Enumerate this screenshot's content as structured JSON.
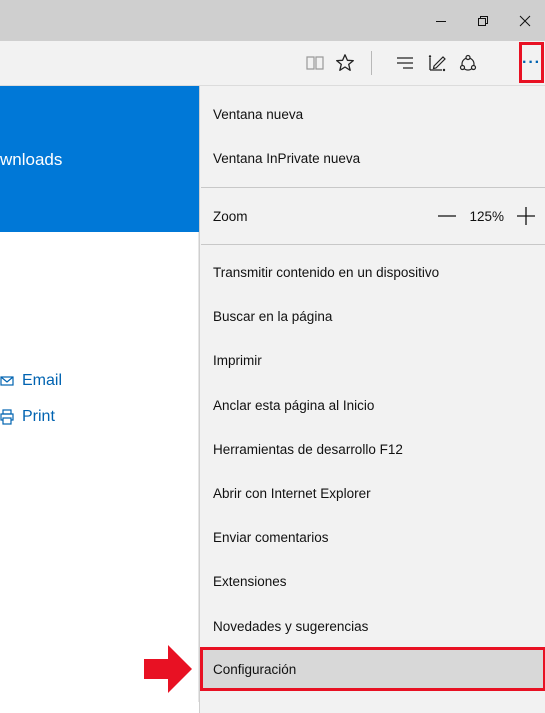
{
  "window": {
    "minimize_icon": "minimize-icon",
    "restore_icon": "restore-icon",
    "close_icon": "close-icon"
  },
  "toolbar": {
    "icons": [
      "reading-view-icon",
      "favorites-star-icon",
      "hub-icon",
      "web-note-icon",
      "share-icon"
    ],
    "more_label": "···"
  },
  "page": {
    "banner_text": "wnloads",
    "email_label": "Email",
    "print_label": "Print"
  },
  "menu": {
    "new_window": "Ventana nueva",
    "new_inprivate": "Ventana InPrivate nueva",
    "zoom_label": "Zoom",
    "zoom_value": "125%",
    "cast": "Transmitir contenido en un dispositivo",
    "find": "Buscar en la página",
    "print": "Imprimir",
    "pin": "Anclar esta página al Inicio",
    "devtools": "Herramientas de desarrollo F12",
    "open_ie": "Abrir con Internet Explorer",
    "feedback": "Enviar comentarios",
    "extensions": "Extensiones",
    "whats_new": "Novedades y sugerencias",
    "settings": "Configuración"
  },
  "colors": {
    "accent_blue": "#0078d7",
    "highlight_red": "#e81123"
  }
}
